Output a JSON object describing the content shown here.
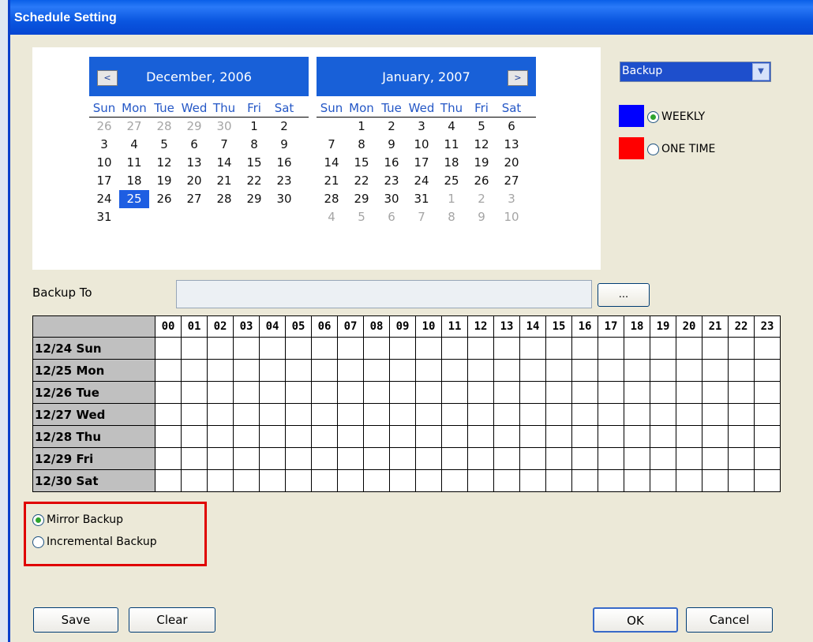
{
  "window": {
    "title": "Schedule Setting"
  },
  "underlay_chars": [
    "",
    "",
    "",
    "",
    "",
    "",
    "",
    "",
    "",
    "",
    "",
    "",
    "",
    "",
    "",
    "",
    "",
    "",
    "",
    "",
    "",
    "",
    "",
    "",
    "",
    "",
    "",
    "",
    "",
    "",
    "",
    "",
    "",
    "",
    "",
    "",
    "",
    "",
    "",
    "",
    "",
    "",
    "",
    "",
    "",
    "",
    "",
    "",
    "",
    "",
    "",
    "",
    "",
    "",
    "",
    "",
    "",
    "",
    "",
    "",
    "",
    "",
    "",
    "",
    "",
    "",
    "",
    "",
    "",
    "",
    "",
    "",
    "",
    "",
    ""
  ],
  "calendar_left": {
    "title": "December, 2006",
    "nav": "<",
    "dow": [
      "Sun",
      "Mon",
      "Tue",
      "Wed",
      "Thu",
      "Fri",
      "Sat"
    ],
    "weeks": [
      [
        "26*",
        "27*",
        "28*",
        "29*",
        "30*",
        "1",
        "2"
      ],
      [
        "3",
        "4",
        "5",
        "6",
        "7",
        "8",
        "9"
      ],
      [
        "10",
        "11",
        "12",
        "13",
        "14",
        "15",
        "16"
      ],
      [
        "17",
        "18",
        "19",
        "20",
        "21",
        "22",
        "23"
      ],
      [
        "24",
        "25!",
        "26",
        "27",
        "28",
        "29",
        "30"
      ],
      [
        "31",
        "",
        "",
        "",
        "",
        "",
        ""
      ]
    ]
  },
  "calendar_right": {
    "title": "January, 2007",
    "nav": ">",
    "dow": [
      "Sun",
      "Mon",
      "Tue",
      "Wed",
      "Thu",
      "Fri",
      "Sat"
    ],
    "weeks": [
      [
        "",
        "1",
        "2",
        "3",
        "4",
        "5",
        "6"
      ],
      [
        "7",
        "8",
        "9",
        "10",
        "11",
        "12",
        "13"
      ],
      [
        "14",
        "15",
        "16",
        "17",
        "18",
        "19",
        "20"
      ],
      [
        "21",
        "22",
        "23",
        "24",
        "25",
        "26",
        "27"
      ],
      [
        "28",
        "29",
        "30",
        "31",
        "1*",
        "2*",
        "3*"
      ],
      [
        "4*",
        "5*",
        "6*",
        "7*",
        "8*",
        "9*",
        "10*"
      ]
    ]
  },
  "mode_select": {
    "value": "Backup"
  },
  "legend": [
    {
      "color": "#0000ff",
      "label": "WEEKLY",
      "checked": true
    },
    {
      "color": "#ff0000",
      "label": "ONE TIME",
      "checked": false
    }
  ],
  "backup_to": {
    "label": "Backup To",
    "value": "",
    "browse_label": "..."
  },
  "schedule": {
    "hours": [
      "00",
      "01",
      "02",
      "03",
      "04",
      "05",
      "06",
      "07",
      "08",
      "09",
      "10",
      "11",
      "12",
      "13",
      "14",
      "15",
      "16",
      "17",
      "18",
      "19",
      "20",
      "21",
      "22",
      "23"
    ],
    "days": [
      "12/24 Sun",
      "12/25 Mon",
      "12/26 Tue",
      "12/27 Wed",
      "12/28 Thu",
      "12/29 Fri",
      "12/30 Sat"
    ]
  },
  "backup_type": [
    {
      "label": "Mirror Backup",
      "checked": true
    },
    {
      "label": "Incremental Backup",
      "checked": false
    }
  ],
  "buttons": {
    "save": "Save",
    "clear": "Clear",
    "ok": "OK",
    "cancel": "Cancel"
  }
}
